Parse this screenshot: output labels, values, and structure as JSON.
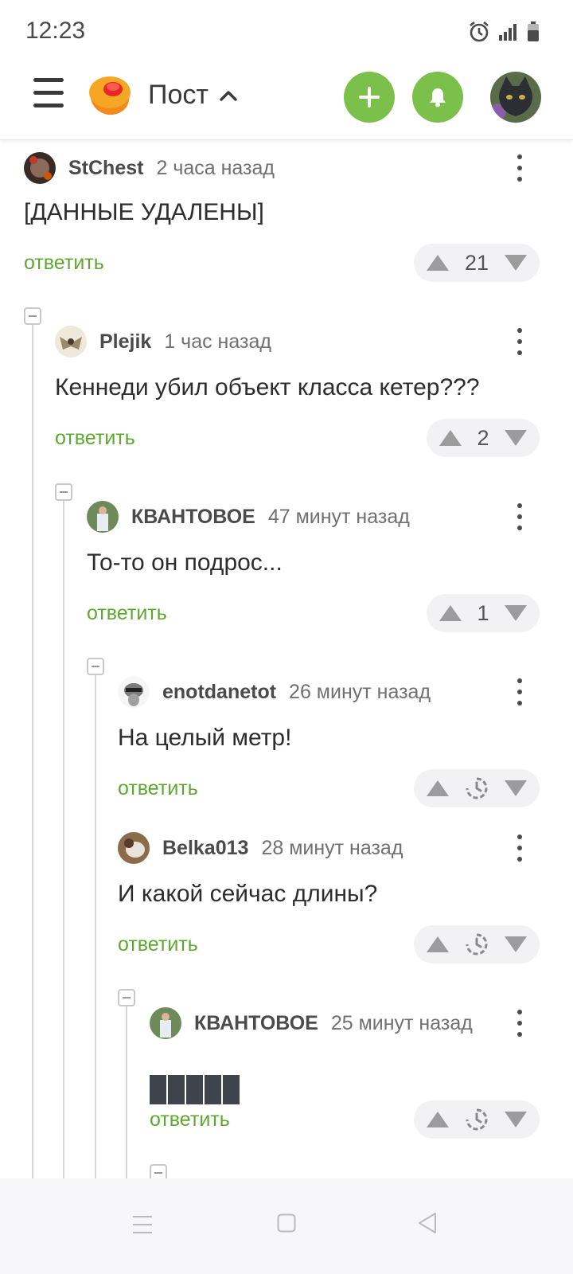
{
  "status_bar": {
    "time": "12:23",
    "icons": [
      "alarm-icon",
      "signal-icon",
      "battery-icon"
    ]
  },
  "header": {
    "title": "Пост",
    "icons": [
      "menu-icon",
      "logo-icon",
      "chevron-up-icon",
      "plus-icon",
      "bell-icon",
      "user-avatar"
    ],
    "accent_color": "#7ac04b"
  },
  "comments": [
    {
      "author": "StChest",
      "time": "2 часа назад",
      "text": "[ДАННЫЕ УДАЛЕНЫ]",
      "reply": "ответить",
      "rating": "21"
    },
    {
      "author": "Plejik",
      "time": "1 час назад",
      "text": "Кеннеди убил объект класса кетер???",
      "reply": "ответить",
      "rating": "2"
    },
    {
      "author": "КВАНТОВОЕ",
      "time": "47 минут назад",
      "text": "То-то он подрос...",
      "reply": "ответить",
      "rating": "1"
    },
    {
      "author": "enotdanetot",
      "time": "26 минут назад",
      "text": "На целый метр!",
      "reply": "ответить",
      "rating": null
    },
    {
      "author": "Belka013",
      "time": "28 минут назад",
      "text": "И какой сейчас длины?",
      "reply": "ответить",
      "rating": null
    },
    {
      "author": "КВАНТОВОЕ",
      "time": "25 минут назад",
      "text": null,
      "redacted_blocks": 5,
      "reply": "ответить",
      "rating": null
    }
  ],
  "nav_bar": {
    "icons": [
      "menu-lines-icon",
      "home-square-icon",
      "back-triangle-icon"
    ]
  }
}
